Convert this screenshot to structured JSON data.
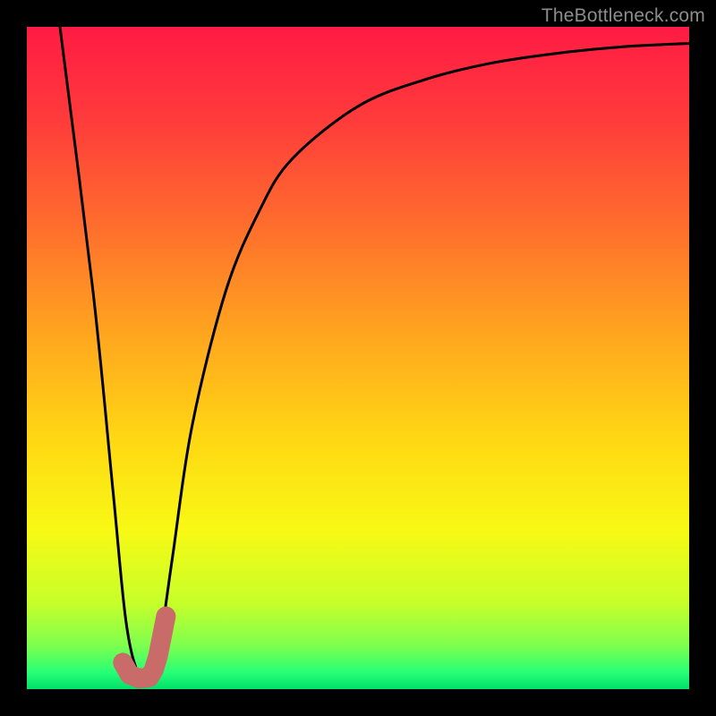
{
  "watermark": "TheBottleneck.com",
  "colors": {
    "frame": "#000000",
    "gradient_stops": [
      {
        "offset": 0.0,
        "color": "#ff1b44"
      },
      {
        "offset": 0.14,
        "color": "#ff3b3b"
      },
      {
        "offset": 0.3,
        "color": "#ff6d2d"
      },
      {
        "offset": 0.46,
        "color": "#ffa41f"
      },
      {
        "offset": 0.62,
        "color": "#ffd713"
      },
      {
        "offset": 0.76,
        "color": "#f8f914"
      },
      {
        "offset": 0.87,
        "color": "#c7ff2a"
      },
      {
        "offset": 0.935,
        "color": "#7dff4f"
      },
      {
        "offset": 0.975,
        "color": "#26ff76"
      },
      {
        "offset": 1.0,
        "color": "#00e06b"
      }
    ],
    "curve": "#000000",
    "marker": "#c96b69"
  },
  "chart_data": {
    "type": "line",
    "title": "",
    "xlabel": "",
    "ylabel": "",
    "xlim": [
      0,
      100
    ],
    "ylim": [
      0,
      100
    ],
    "series": [
      {
        "name": "bottleneck-curve",
        "x": [
          5,
          10,
          13,
          15,
          17,
          19,
          20,
          22,
          25,
          30,
          35,
          40,
          50,
          60,
          70,
          80,
          90,
          100
        ],
        "y": [
          100,
          60,
          30,
          10,
          2,
          2,
          6,
          20,
          40,
          60,
          72,
          80,
          88,
          92,
          94.5,
          96,
          97,
          97.5
        ]
      }
    ],
    "marker": {
      "name": "j-shape-marker",
      "x": [
        14.5,
        15.5,
        17.0,
        18.5,
        19.2,
        19.8,
        20.4,
        21.0
      ],
      "y": [
        4.0,
        2.2,
        1.6,
        1.8,
        3.0,
        5.0,
        8.0,
        11.0
      ]
    }
  }
}
